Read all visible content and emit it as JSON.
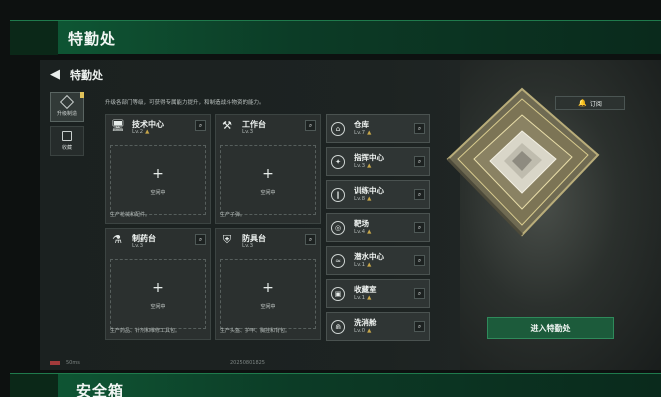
{
  "top_banner": {
    "title": "特勤处"
  },
  "bottom_banner": {
    "title": "安全箱"
  },
  "header": {
    "title": "特勤处"
  },
  "side_tabs": [
    {
      "label": "升级制造",
      "icon": "upgrade-icon",
      "active": true
    },
    {
      "label": "收藏",
      "icon": "collection-icon",
      "active": false
    }
  ],
  "description": "升级各部门等级，可获得专属能力提升，和制造战斗物资的能力。",
  "subscribe": {
    "label": "订阅",
    "icon": "bell-icon"
  },
  "workshops": [
    {
      "name": "技术中心",
      "level": "Lv.2",
      "slot": "空闲中",
      "desc": "生产枪械和配件。",
      "icon": "monitor-icon"
    },
    {
      "name": "工作台",
      "level": "Lv.3",
      "slot": "空闲中",
      "desc": "生产子弹。",
      "icon": "tools-icon"
    },
    {
      "name": "制药台",
      "level": "Lv.3",
      "slot": "空闲中",
      "desc": "生产药品、针剂和维修工具包。",
      "icon": "pharmacy-icon"
    },
    {
      "name": "防具台",
      "level": "Lv.3",
      "slot": "空闲中",
      "desc": "生产头盔、护甲、胸挂和背包。",
      "icon": "armor-icon"
    }
  ],
  "facilities": [
    {
      "name": "仓库",
      "level": "Lv.7",
      "icon": "warehouse-icon"
    },
    {
      "name": "指挥中心",
      "level": "Lv.3",
      "icon": "command-icon"
    },
    {
      "name": "训练中心",
      "level": "Lv.8",
      "icon": "dumbbell-icon"
    },
    {
      "name": "靶场",
      "level": "Lv.4",
      "icon": "target-icon"
    },
    {
      "name": "潜水中心",
      "level": "Lv.1",
      "icon": "dive-icon"
    },
    {
      "name": "收藏室",
      "level": "Lv.1",
      "icon": "vault-icon"
    },
    {
      "name": "洗消舱",
      "level": "Lv.0",
      "icon": "shower-icon"
    }
  ],
  "enter_button": {
    "label": "进入特勤处"
  },
  "status": {
    "ping": "50ms",
    "timestamp": "20250801825"
  }
}
